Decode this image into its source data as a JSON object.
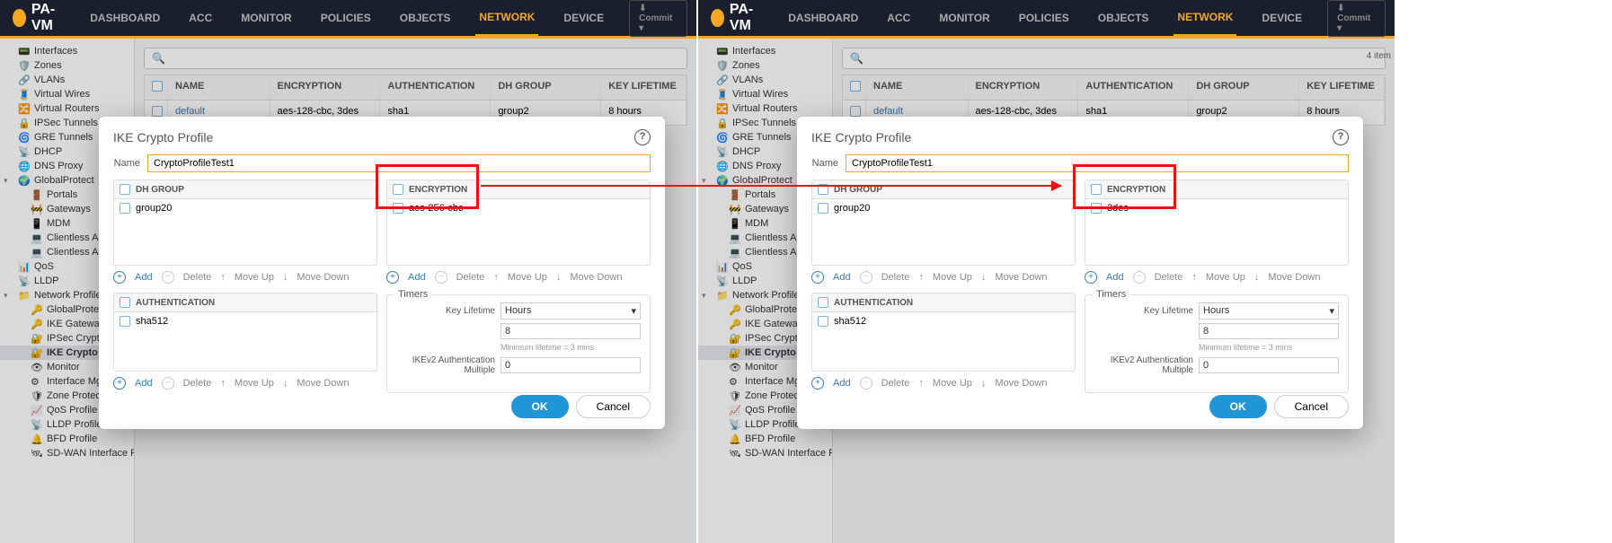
{
  "brand": "PA-VM",
  "nav": {
    "items": [
      "DASHBOARD",
      "ACC",
      "MONITOR",
      "POLICIES",
      "OBJECTS",
      "NETWORK",
      "DEVICE"
    ],
    "active": "NETWORK",
    "commit": "Commit"
  },
  "sidebar": {
    "items": [
      "Interfaces",
      "Zones",
      "VLANs",
      "Virtual Wires",
      "Virtual Routers",
      "IPSec Tunnels",
      "GRE Tunnels",
      "DHCP",
      "DNS Proxy"
    ],
    "gp": "GlobalProtect",
    "gp_children": [
      "Portals",
      "Gateways",
      "MDM",
      "Clientless Ap",
      "Clientless Ap"
    ],
    "items2": [
      "QoS",
      "LLDP"
    ],
    "np": "Network Profiles",
    "np_children": [
      "GlobalProtect",
      "IKE Gateway",
      "IPSec Crypto",
      "IKE Crypto",
      "Monitor",
      "Interface Mg",
      "Zone Protect",
      "QoS Profile",
      "LLDP Profile",
      "BFD Profile",
      "SD-WAN Interface Profile"
    ]
  },
  "grid": {
    "headers": [
      "NAME",
      "ENCRYPTION",
      "AUTHENTICATION",
      "DH GROUP",
      "KEY LIFETIME"
    ],
    "row": {
      "name": "default",
      "enc": "aes-128-cbc, 3des",
      "auth": "sha1",
      "dh": "group2",
      "life": "8 hours"
    },
    "items_count": "4 item"
  },
  "modal": {
    "title": "IKE Crypto Profile",
    "name_label": "Name",
    "name_value_left": "CryptoProfileTest1",
    "name_value_right": "CryptoProfileTest1",
    "dh": {
      "header": "DH GROUP",
      "value": "group20"
    },
    "enc": {
      "header": "ENCRYPTION",
      "value_left": "aes-256-cbc",
      "value_right": "3des"
    },
    "auth": {
      "header": "AUTHENTICATION",
      "value": "sha512"
    },
    "toolbar": {
      "add": "Add",
      "delete": "Delete",
      "moveup": "Move Up",
      "movedown": "Move Down"
    },
    "timers": {
      "frame": "Timers",
      "key_label": "Key Lifetime",
      "key_unit": "Hours",
      "key_value": "8",
      "hint": "Minimum lifetime = 3 mins",
      "ikev2_label": "IKEv2 Authentication Multiple",
      "ikev2_value": "0"
    },
    "ok": "OK",
    "cancel": "Cancel"
  },
  "search_icon": "🔍"
}
